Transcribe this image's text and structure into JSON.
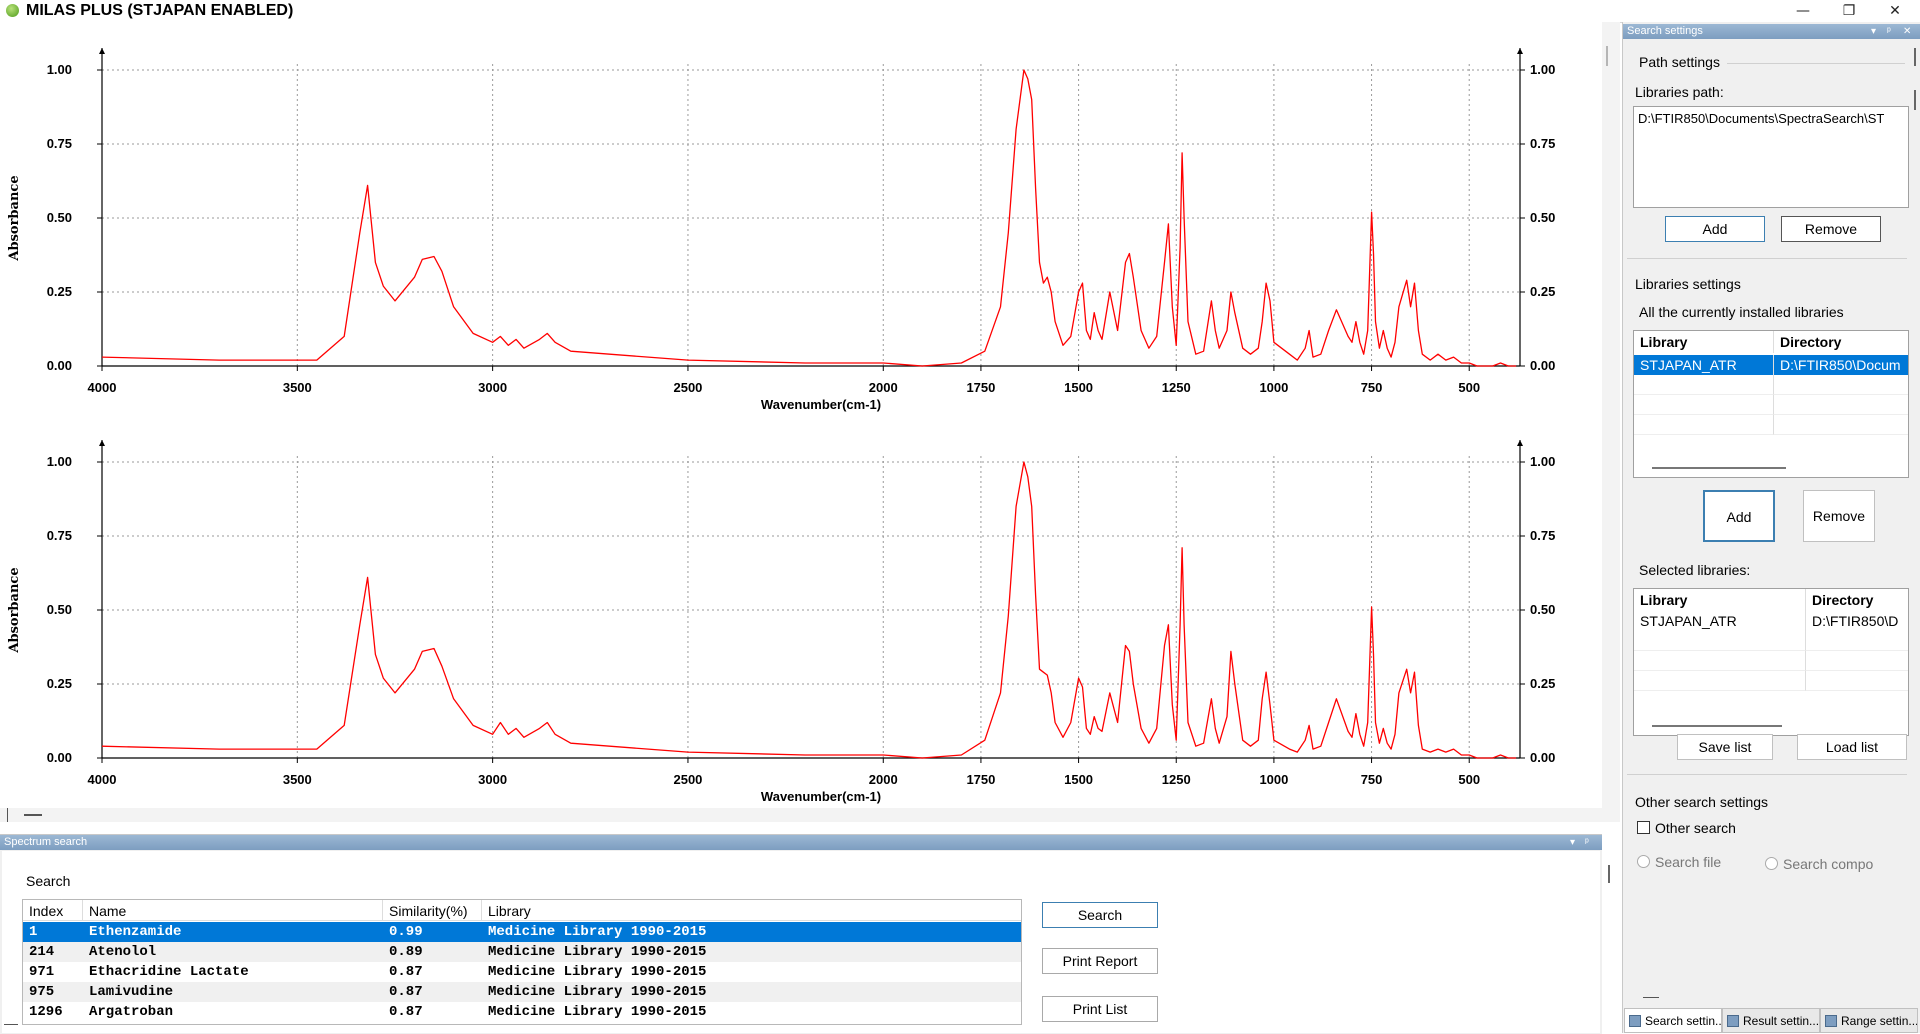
{
  "window": {
    "title": "MILAS PLUS (STJAPAN ENABLED)",
    "minimize_glyph": "—",
    "restore_glyph": "❐",
    "close_glyph": "✕"
  },
  "charts": [
    {
      "ylabel": "Absorbance",
      "xlabel": "Wavenumber(cm-1)",
      "y_ticks": [
        "1.00",
        "0.75",
        "0.50",
        "0.25",
        "0.00"
      ],
      "x_ticks": [
        "4000",
        "3500",
        "3000",
        "2500",
        "2000",
        "1750",
        "1500",
        "1250",
        "1000",
        "750",
        "500"
      ],
      "line_color": "#ff0000"
    },
    {
      "ylabel": "Absorbance",
      "xlabel": "Wavenumber(cm-1)",
      "y_ticks": [
        "1.00",
        "0.75",
        "0.50",
        "0.25",
        "0.00"
      ],
      "x_ticks": [
        "4000",
        "3500",
        "3000",
        "2500",
        "2000",
        "1750",
        "1500",
        "1250",
        "1000",
        "750",
        "500"
      ],
      "line_color": "#ff0000"
    }
  ],
  "chart_data": [
    {
      "type": "line",
      "xlabel": "Wavenumber(cm-1)",
      "ylabel": "Absorbance",
      "xlim": [
        4000,
        370
      ],
      "ylim": [
        0,
        1.0
      ],
      "grid": true,
      "x": [
        4000,
        3700,
        3450,
        3380,
        3340,
        3320,
        3300,
        3280,
        3250,
        3200,
        3180,
        3150,
        3130,
        3100,
        3050,
        3000,
        2980,
        2960,
        2940,
        2920,
        2880,
        2860,
        2840,
        2800,
        2700,
        2500,
        2200,
        2000,
        1900,
        1800,
        1740,
        1700,
        1680,
        1660,
        1640,
        1630,
        1620,
        1610,
        1600,
        1590,
        1580,
        1570,
        1560,
        1540,
        1520,
        1500,
        1490,
        1480,
        1470,
        1460,
        1450,
        1440,
        1420,
        1400,
        1380,
        1370,
        1360,
        1340,
        1320,
        1300,
        1280,
        1270,
        1260,
        1250,
        1240,
        1235,
        1230,
        1220,
        1200,
        1180,
        1160,
        1150,
        1140,
        1120,
        1110,
        1100,
        1080,
        1060,
        1040,
        1030,
        1020,
        1010,
        1000,
        960,
        940,
        920,
        910,
        900,
        880,
        860,
        840,
        810,
        800,
        790,
        780,
        770,
        760,
        750,
        745,
        740,
        730,
        720,
        710,
        700,
        690,
        680,
        660,
        650,
        640,
        630,
        620,
        600,
        580,
        560,
        540,
        520,
        500,
        480,
        460,
        440,
        420,
        400,
        380
      ],
      "y": [
        0.03,
        0.02,
        0.02,
        0.1,
        0.45,
        0.61,
        0.35,
        0.27,
        0.22,
        0.3,
        0.36,
        0.37,
        0.32,
        0.2,
        0.11,
        0.08,
        0.1,
        0.07,
        0.09,
        0.06,
        0.09,
        0.11,
        0.08,
        0.05,
        0.04,
        0.02,
        0.01,
        0.01,
        0.0,
        0.01,
        0.05,
        0.2,
        0.45,
        0.8,
        1.0,
        0.97,
        0.9,
        0.6,
        0.35,
        0.28,
        0.3,
        0.25,
        0.15,
        0.07,
        0.1,
        0.25,
        0.28,
        0.12,
        0.09,
        0.18,
        0.12,
        0.09,
        0.25,
        0.12,
        0.35,
        0.38,
        0.3,
        0.12,
        0.06,
        0.1,
        0.35,
        0.48,
        0.2,
        0.07,
        0.4,
        0.72,
        0.5,
        0.15,
        0.04,
        0.05,
        0.22,
        0.12,
        0.06,
        0.12,
        0.25,
        0.18,
        0.06,
        0.04,
        0.06,
        0.15,
        0.28,
        0.22,
        0.08,
        0.04,
        0.02,
        0.06,
        0.12,
        0.03,
        0.04,
        0.12,
        0.19,
        0.1,
        0.08,
        0.15,
        0.08,
        0.04,
        0.12,
        0.52,
        0.38,
        0.15,
        0.06,
        0.12,
        0.06,
        0.03,
        0.08,
        0.2,
        0.29,
        0.2,
        0.28,
        0.12,
        0.04,
        0.02,
        0.04,
        0.02,
        0.03,
        0.01,
        0.01,
        0.0,
        0.0,
        0.0,
        0.01,
        0.0,
        0.0
      ]
    },
    {
      "type": "line",
      "xlabel": "Wavenumber(cm-1)",
      "ylabel": "Absorbance",
      "xlim": [
        4000,
        370
      ],
      "ylim": [
        0,
        1.0
      ],
      "grid": true,
      "x": [
        4000,
        3700,
        3450,
        3380,
        3340,
        3320,
        3300,
        3280,
        3250,
        3200,
        3180,
        3150,
        3130,
        3100,
        3050,
        3000,
        2980,
        2960,
        2940,
        2920,
        2880,
        2860,
        2840,
        2800,
        2700,
        2500,
        2200,
        2000,
        1900,
        1800,
        1740,
        1700,
        1680,
        1660,
        1640,
        1630,
        1620,
        1610,
        1600,
        1590,
        1580,
        1570,
        1560,
        1540,
        1520,
        1500,
        1490,
        1480,
        1470,
        1460,
        1450,
        1440,
        1420,
        1400,
        1380,
        1370,
        1360,
        1340,
        1320,
        1300,
        1280,
        1270,
        1260,
        1250,
        1240,
        1235,
        1230,
        1220,
        1200,
        1180,
        1160,
        1150,
        1140,
        1120,
        1110,
        1100,
        1080,
        1060,
        1040,
        1030,
        1020,
        1010,
        1000,
        960,
        940,
        920,
        910,
        900,
        880,
        860,
        840,
        810,
        800,
        790,
        780,
        770,
        760,
        750,
        745,
        740,
        730,
        720,
        710,
        700,
        690,
        680,
        660,
        650,
        640,
        630,
        620,
        600,
        580,
        560,
        540,
        520,
        500,
        480,
        460,
        440,
        420,
        400,
        380
      ],
      "y": [
        0.04,
        0.03,
        0.03,
        0.11,
        0.45,
        0.61,
        0.35,
        0.27,
        0.22,
        0.3,
        0.36,
        0.37,
        0.31,
        0.2,
        0.11,
        0.08,
        0.12,
        0.08,
        0.1,
        0.07,
        0.1,
        0.12,
        0.08,
        0.05,
        0.04,
        0.02,
        0.01,
        0.01,
        0.0,
        0.01,
        0.06,
        0.22,
        0.48,
        0.85,
        1.0,
        0.95,
        0.85,
        0.55,
        0.3,
        0.29,
        0.28,
        0.22,
        0.12,
        0.07,
        0.12,
        0.27,
        0.24,
        0.1,
        0.08,
        0.14,
        0.1,
        0.09,
        0.22,
        0.12,
        0.38,
        0.36,
        0.25,
        0.1,
        0.05,
        0.1,
        0.38,
        0.45,
        0.18,
        0.06,
        0.45,
        0.71,
        0.45,
        0.12,
        0.04,
        0.05,
        0.2,
        0.1,
        0.05,
        0.14,
        0.36,
        0.25,
        0.06,
        0.04,
        0.06,
        0.2,
        0.29,
        0.18,
        0.06,
        0.03,
        0.02,
        0.06,
        0.11,
        0.03,
        0.04,
        0.12,
        0.2,
        0.09,
        0.07,
        0.15,
        0.08,
        0.04,
        0.12,
        0.51,
        0.35,
        0.12,
        0.05,
        0.1,
        0.05,
        0.03,
        0.08,
        0.22,
        0.3,
        0.22,
        0.29,
        0.11,
        0.03,
        0.02,
        0.03,
        0.02,
        0.03,
        0.01,
        0.01,
        0.0,
        0.0,
        0.0,
        0.01,
        0.0,
        0.0
      ]
    }
  ],
  "search_panel": {
    "header": "Spectrum search",
    "search_label": "Search",
    "columns": [
      "Index",
      "Name",
      "Similarity(%)",
      "Library"
    ],
    "rows": [
      {
        "index": "1",
        "name": "Ethenzamide",
        "similarity": "0.99",
        "library": "Medicine Library 1990-2015"
      },
      {
        "index": "214",
        "name": "Atenolol",
        "similarity": "0.89",
        "library": "Medicine Library 1990-2015"
      },
      {
        "index": "971",
        "name": "Ethacridine Lactate",
        "similarity": "0.87",
        "library": "Medicine Library 1990-2015"
      },
      {
        "index": "975",
        "name": "Lamivudine",
        "similarity": "0.87",
        "library": "Medicine Library 1990-2015"
      },
      {
        "index": "1296",
        "name": "Argatroban",
        "similarity": "0.87",
        "library": "Medicine Library 1990-2015"
      }
    ],
    "buttons": {
      "search": "Search",
      "print_report": "Print Report",
      "print_list": "Print List"
    }
  },
  "settings_panel": {
    "header": "Search settings",
    "path_settings": "Path settings",
    "libraries_path_label": "Libraries path:",
    "libraries_path_value": "D:\\FTIR850\\Documents\\SpectraSearch\\ST",
    "add": "Add",
    "remove": "Remove",
    "libraries_settings": "Libraries settings",
    "installed_label": "All the currently installed libraries",
    "grid_columns": [
      "Library",
      "Directory"
    ],
    "installed_rows": [
      {
        "library": "STJAPAN_ATR",
        "directory": "D:\\FTIR850\\Docum"
      }
    ],
    "add2": "Add",
    "remove2": "Remove",
    "selected_label": "Selected libraries:",
    "selected_rows": [
      {
        "library": "STJAPAN_ATR",
        "directory": "D:\\FTIR850\\D"
      }
    ],
    "save_list": "Save list",
    "load_list": "Load list",
    "other_search_settings": "Other search settings",
    "other_search": "Other search",
    "search_file": "Search file",
    "search_compo": "Search compo"
  },
  "bottom_tabs": [
    "Search settin...",
    "Result settin...",
    "Range settin..."
  ]
}
